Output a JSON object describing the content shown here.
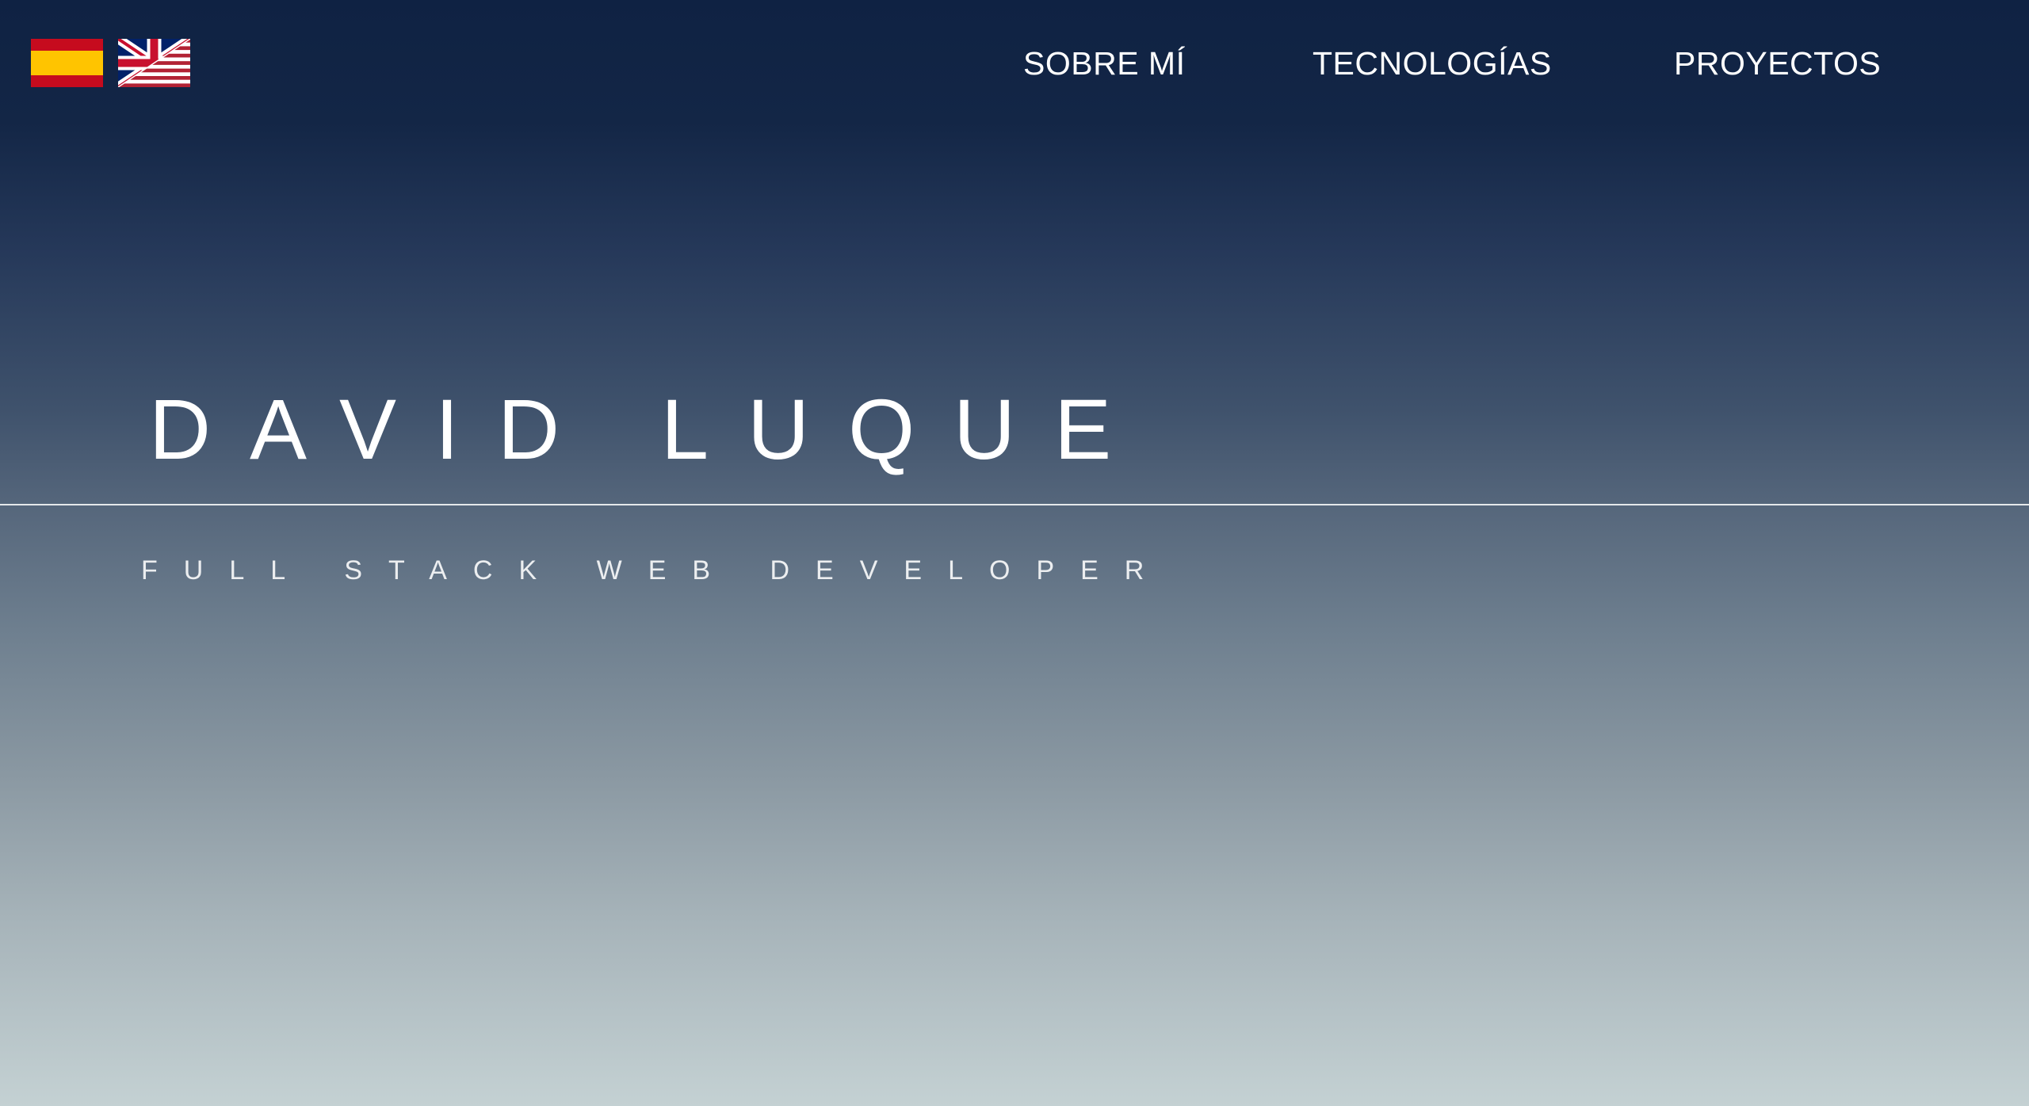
{
  "language_switcher": {
    "items": [
      {
        "icon": "spain-flag-icon",
        "colors": [
          "#c60b1e",
          "#ffc400"
        ]
      },
      {
        "icon": "us-uk-flag-icon",
        "colors": [
          "#b22234",
          "#ffffff",
          "#3c3b6e",
          "#012169",
          "#c8102e"
        ]
      }
    ]
  },
  "nav": {
    "about": "SOBRE MÍ",
    "technologies": "TECNOLOGÍAS",
    "projects": "PROYECTOS"
  },
  "hero": {
    "name": "DAVID LUQUE",
    "subtitle": "FULL STACK WEB DEVELOPER"
  },
  "colors": {
    "background_top": "#0f2243",
    "background_bottom": "#c4d1d3",
    "text": "#ffffff"
  }
}
